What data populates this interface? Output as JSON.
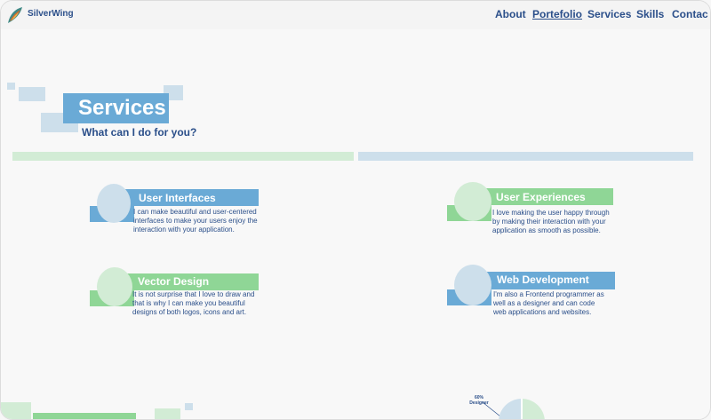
{
  "header": {
    "brand": "SilverWing",
    "nav": [
      {
        "label": "About"
      },
      {
        "label": "Portefolio"
      },
      {
        "label": "Services"
      },
      {
        "label": "Skills"
      },
      {
        "label": "Contac"
      }
    ]
  },
  "hero": {
    "title": "Services",
    "subtitle": "What can I do for you?"
  },
  "services": [
    {
      "title": "User Interfaces",
      "description": "I can make beautiful and user-centered\ninterfaces to make your users enjoy the\ninteraction with your application."
    },
    {
      "title": "User Experiences",
      "description": "I love making the user happy through\nby making their interaction with your\napplication as smooth as possible."
    },
    {
      "title": "Vector Design",
      "description": "It is not surprise that I love to draw and\nthat is why I can make you beautiful\ndesigns of both logos, icons and art."
    },
    {
      "title": "Web Development",
      "description": "I'm also a Frontend programmer as\nwell as a designer and can code\nweb applications and websites."
    }
  ],
  "skills_preview": {
    "pie_label_line1": "60%",
    "pie_label_line2": "Designer"
  },
  "colors": {
    "blue": "#6aaad6",
    "green": "#8fd696",
    "light_blue": "#cddfeb",
    "light_green": "#d2ecd5",
    "text": "#2b4f8a"
  }
}
